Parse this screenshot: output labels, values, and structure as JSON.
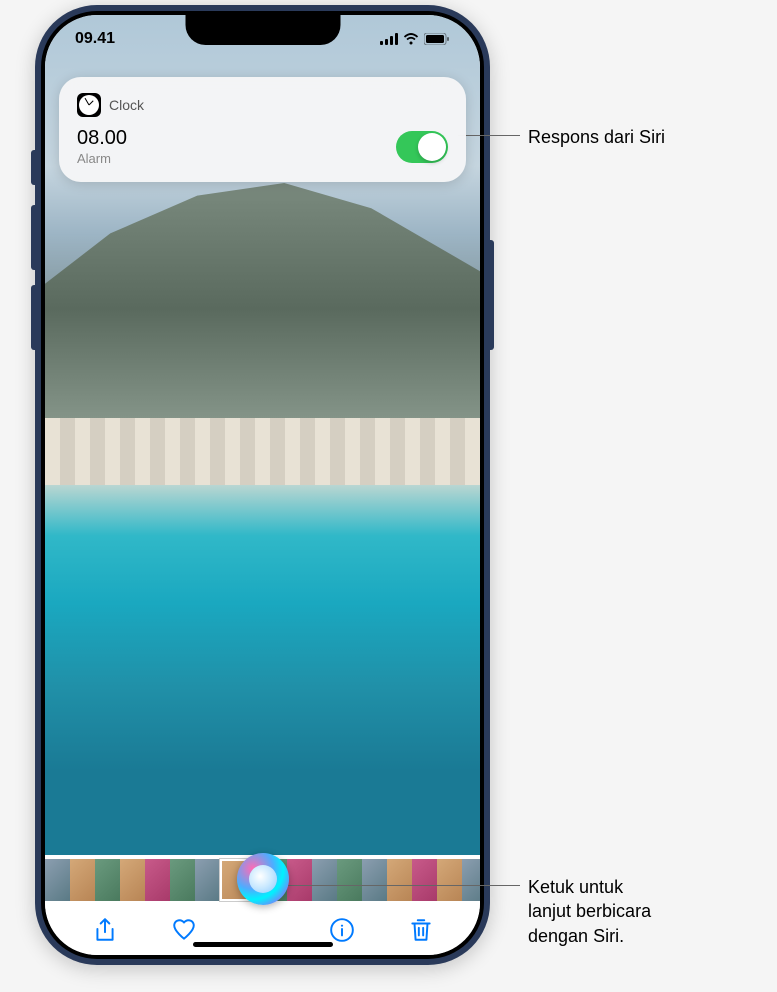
{
  "status_bar": {
    "time": "09.41"
  },
  "siri_response": {
    "app_name": "Clock",
    "alarm_time": "08.00",
    "alarm_label": "Alarm",
    "toggle_on": true
  },
  "photo_toolbar": {
    "share_icon": "share-icon",
    "favorite_icon": "heart-icon",
    "info_icon": "info-icon",
    "delete_icon": "trash-icon"
  },
  "callouts": {
    "siri_response": "Respons dari Siri",
    "siri_tap": "Ketuk untuk\nlanjut berbicara\ndengan Siri."
  }
}
